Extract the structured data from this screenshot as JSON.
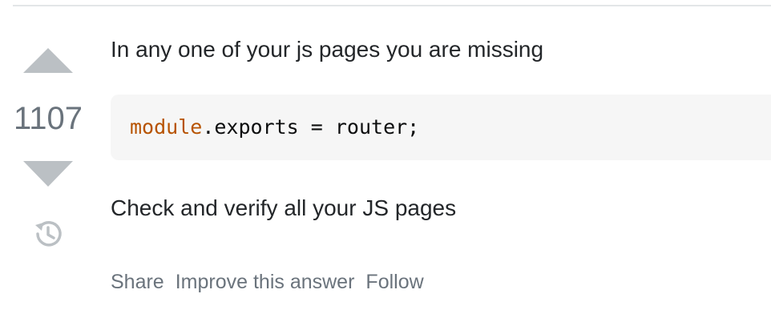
{
  "vote": {
    "score": "1107",
    "upvote_icon": "triangle-up-icon",
    "downvote_icon": "triangle-down-icon",
    "history_icon": "history-icon"
  },
  "answer": {
    "paragraph_1": "In any one of your js pages you are missing",
    "code": {
      "keyword": "module",
      "rest": ".exports = router;"
    },
    "paragraph_2": "Check and verify all your JS pages"
  },
  "actions": {
    "share": "Share",
    "improve": "Improve this answer",
    "follow": "Follow"
  },
  "colors": {
    "vote_arrow": "#bbc0c4",
    "vote_count": "#6a737c",
    "code_bg": "#f6f6f6",
    "code_keyword": "#b75301",
    "action_text": "#6a737c"
  }
}
